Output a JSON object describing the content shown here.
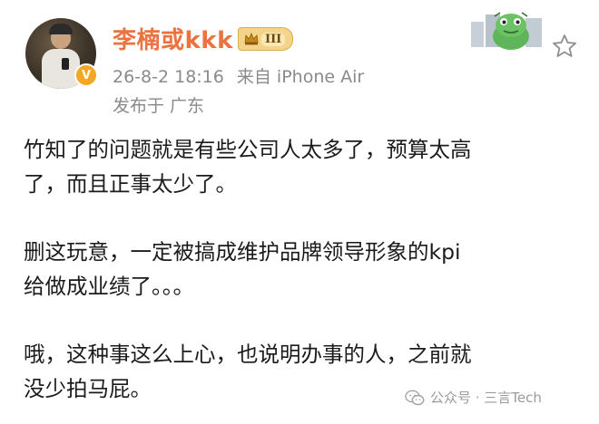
{
  "post": {
    "author": {
      "name": "李楠或kkk",
      "level_badge": "III",
      "verified_mark": "V"
    },
    "timestamp": "26-8-2 18:16",
    "source": "来自 iPhone Air",
    "location": "发布于 广东",
    "paragraphs": [
      "竹知了的问题就是有些公司人太多了，预算太高\n了，而且正事太少了。",
      "删这玩意，一定被搞成维护品牌领导形象的kpi\n给做成业绩了。。。",
      "哦，这种事这么上心，也说明办事的人，之前就\n没少拍马屁。"
    ]
  },
  "watermark": {
    "text": "公众号 · 三言Tech"
  },
  "icons": {
    "favorite": "star-outline-icon",
    "verified": "verified-badge-icon",
    "level": "crown-icon",
    "watermark": "wechat-icon",
    "sticker": "frog-sticker-icon"
  },
  "colors": {
    "name": "#eb7340",
    "meta": "#8a8a8a",
    "body_text": "#1b1b1b",
    "verified": "#f5a623",
    "badge": "#f4d488",
    "watermark": "#9b9b9b"
  }
}
